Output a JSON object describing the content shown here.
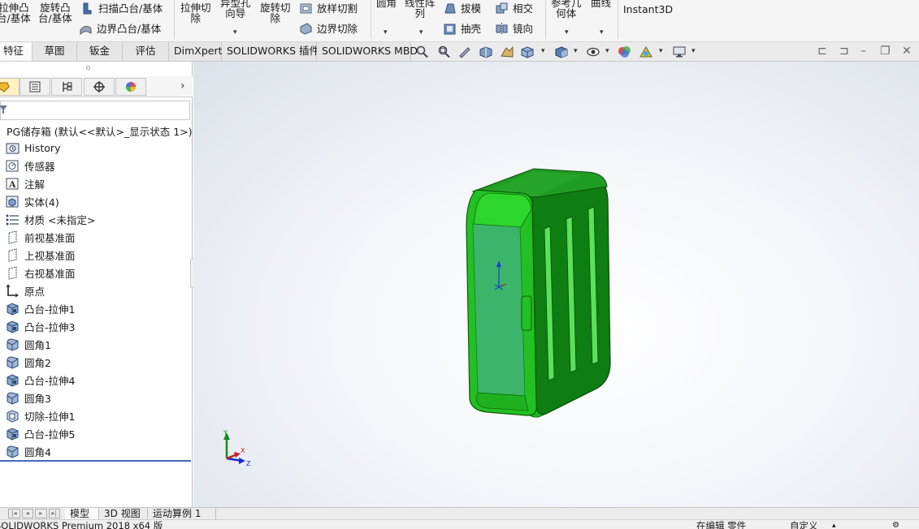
{
  "ribbon": {
    "extrude_boss_l1": "拉伸凸",
    "extrude_boss_l2": "台/基体",
    "revolve_boss_l1": "旋转凸",
    "revolve_boss_l2": "台/基体",
    "swept_boss": "扫描凸台/基体",
    "loft_boss": "放样凸台/基体",
    "boundary_boss": "边界凸台/基体",
    "extruded_cut_l1": "拉伸切",
    "extruded_cut_l2": "除",
    "hole_wizard_l1": "异型孔",
    "hole_wizard_l2": "向导",
    "revolved_cut_l1": "旋转切",
    "revolved_cut_l2": "除",
    "swept_cut": "放样切割",
    "boundary_cut": "边界切除",
    "fillet": "圆角",
    "linear_pattern_l1": "线性阵",
    "linear_pattern_l2": "列",
    "draft": "拔模",
    "intersect": "相交",
    "shell": "抽壳",
    "mirror": "镜向",
    "ref_geometry_l1": "参考几",
    "ref_geometry_l2": "何体",
    "curves": "曲线",
    "instant3d": "Instant3D"
  },
  "command_tabs": [
    "特征",
    "草图",
    "钣金",
    "评估",
    "DimXpert",
    "SOLIDWORKS 插件",
    "SOLIDWORKS MBD"
  ],
  "tree": {
    "root": "PG储存箱 (默认<<默认>_显示状态 1>)",
    "items": [
      {
        "label": "History",
        "icon": "history-folder-icon"
      },
      {
        "label": "传感器",
        "icon": "sensor-icon"
      },
      {
        "label": "注解",
        "icon": "annotation-icon"
      },
      {
        "label": "实体(4)",
        "icon": "solid-bodies-icon"
      },
      {
        "label": "材质 <未指定>",
        "icon": "material-icon"
      },
      {
        "label": "前视基准面",
        "icon": "plane-icon"
      },
      {
        "label": "上视基准面",
        "icon": "plane-icon"
      },
      {
        "label": "右视基准面",
        "icon": "plane-icon"
      },
      {
        "label": "原点",
        "icon": "origin-icon"
      },
      {
        "label": "凸台-拉伸1",
        "icon": "boss-extrude-icon"
      },
      {
        "label": "凸台-拉伸3",
        "icon": "boss-extrude-icon"
      },
      {
        "label": "圆角1",
        "icon": "fillet-icon"
      },
      {
        "label": "圆角2",
        "icon": "fillet-icon"
      },
      {
        "label": "凸台-拉伸4",
        "icon": "boss-extrude-icon"
      },
      {
        "label": "圆角3",
        "icon": "fillet-icon"
      },
      {
        "label": "切除-拉伸1",
        "icon": "cut-extrude-icon"
      },
      {
        "label": "凸台-拉伸5",
        "icon": "boss-extrude-icon"
      },
      {
        "label": "圆角4",
        "icon": "fillet-icon"
      }
    ]
  },
  "triad": {
    "x": "X",
    "y": "Y",
    "z": "Z"
  },
  "bottom_tabs": [
    "模型",
    "3D 视图",
    "运动算例 1"
  ],
  "status": {
    "app": "SOLIDWORKS Premium 2018 x64 版",
    "editing": "在编辑 零件",
    "units": "自定义"
  },
  "colors": {
    "model_green": "#22c022",
    "model_dark_green": "#0e7d12",
    "model_face_light": "#3cb56a",
    "ribbon_bg": "#f5f5f5",
    "panel_accent": "#3f6bb8"
  }
}
